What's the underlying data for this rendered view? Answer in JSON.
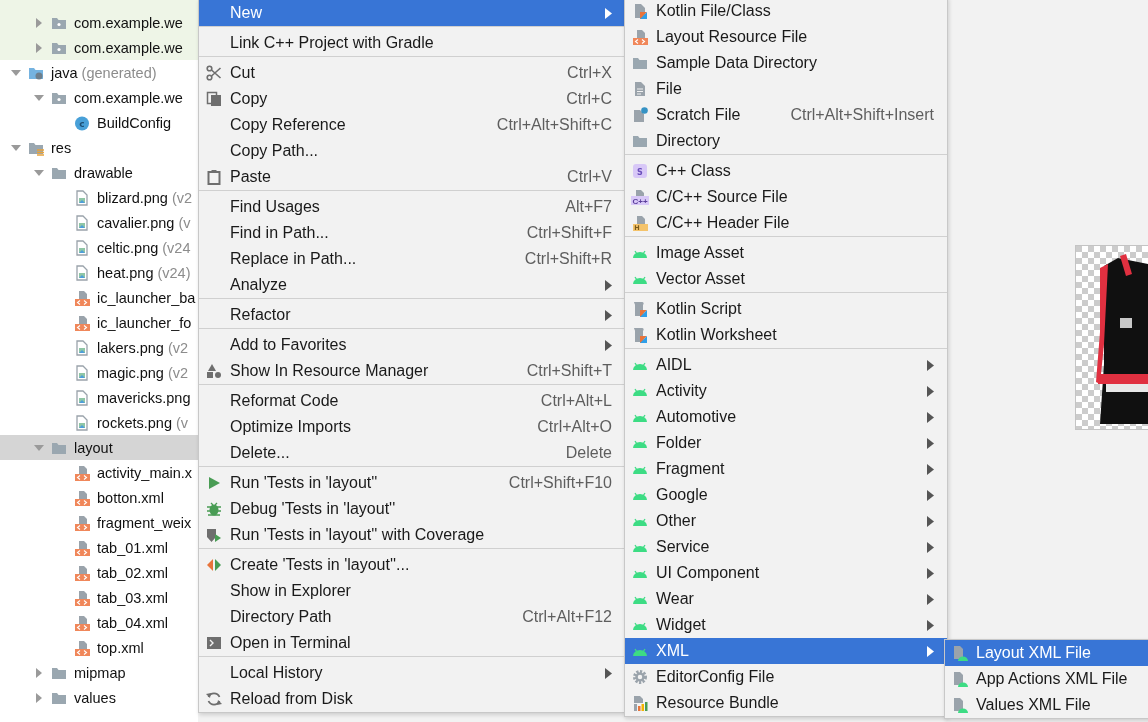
{
  "tree": {
    "items": [
      {
        "children": [
          {
            "label": "com.example.we",
            "kind": "package",
            "expanded": false,
            "selected": false,
            "tinted": true
          },
          {
            "label": "com.example.we",
            "kind": "package",
            "expanded": false,
            "selected": false,
            "tinted": true
          }
        ]
      },
      {
        "label": "java",
        "note": "(generated)",
        "kind": "java-root",
        "expanded": true,
        "selected": false,
        "children": [
          {
            "label": "com.example.we",
            "kind": "package",
            "expanded": true,
            "selected": false,
            "children": [
              {
                "label": "BuildConfig",
                "kind": "class",
                "badge": "c",
                "selected": false
              }
            ]
          }
        ]
      },
      {
        "label": "res",
        "kind": "res-root",
        "expanded": true,
        "selected": false,
        "children": [
          {
            "label": "drawable",
            "kind": "folder",
            "expanded": true,
            "selected": false,
            "children": [
              {
                "label": "blizard.png",
                "note": "(v2",
                "kind": "png",
                "selected": false
              },
              {
                "label": "cavalier.png",
                "note": "(v",
                "kind": "png",
                "selected": false
              },
              {
                "label": "celtic.png",
                "note": "(v24",
                "kind": "png",
                "selected": false
              },
              {
                "label": "heat.png",
                "note": "(v24)",
                "kind": "png",
                "selected": false
              },
              {
                "label": "ic_launcher_ba",
                "kind": "xml",
                "selected": false
              },
              {
                "label": "ic_launcher_fo",
                "kind": "xml",
                "selected": false
              },
              {
                "label": "lakers.png",
                "note": "(v2",
                "kind": "png",
                "selected": false
              },
              {
                "label": "magic.png",
                "note": "(v2",
                "kind": "png",
                "selected": false
              },
              {
                "label": "mavericks.png",
                "kind": "png",
                "selected": false
              },
              {
                "label": "rockets.png",
                "note": "(v",
                "kind": "png",
                "selected": false
              }
            ]
          },
          {
            "label": "layout",
            "kind": "folder",
            "expanded": true,
            "selected": true,
            "children": [
              {
                "label": "activity_main.x",
                "kind": "xml",
                "selected": false
              },
              {
                "label": "botton.xml",
                "kind": "xml",
                "selected": false
              },
              {
                "label": "fragment_weix",
                "kind": "xml",
                "selected": false
              },
              {
                "label": "tab_01.xml",
                "kind": "xml",
                "selected": false
              },
              {
                "label": "tab_02.xml",
                "kind": "xml",
                "selected": false
              },
              {
                "label": "tab_03.xml",
                "kind": "xml",
                "selected": false
              },
              {
                "label": "tab_04.xml",
                "kind": "xml",
                "selected": false
              },
              {
                "label": "top.xml",
                "kind": "xml",
                "selected": false
              }
            ]
          },
          {
            "label": "mipmap",
            "kind": "folder",
            "expanded": false,
            "selected": false
          },
          {
            "label": "values",
            "kind": "folder",
            "expanded": false,
            "selected": false
          }
        ]
      }
    ]
  },
  "context_menu": {
    "groups": [
      [
        {
          "label": "New",
          "kind": "plain",
          "submenu": true,
          "selected": true
        }
      ],
      [
        {
          "label": "Link C++ Project with Gradle",
          "kind": "plain",
          "submenu": false,
          "selected": false
        }
      ],
      [
        {
          "label": "Cut",
          "kind": "scissors",
          "shortcut": "Ctrl+X",
          "submenu": false,
          "selected": false
        },
        {
          "label": "Copy",
          "kind": "copy",
          "shortcut": "Ctrl+C",
          "submenu": false,
          "selected": false
        },
        {
          "label": "Copy Reference",
          "kind": "plain",
          "shortcut": "Ctrl+Alt+Shift+C",
          "submenu": false,
          "selected": false
        },
        {
          "label": "Copy Path...",
          "kind": "plain",
          "submenu": false,
          "selected": false
        },
        {
          "label": "Paste",
          "kind": "paste",
          "shortcut": "Ctrl+V",
          "submenu": false,
          "selected": false
        }
      ],
      [
        {
          "label": "Find Usages",
          "kind": "plain",
          "shortcut": "Alt+F7",
          "submenu": false,
          "selected": false
        },
        {
          "label": "Find in Path...",
          "kind": "plain",
          "shortcut": "Ctrl+Shift+F",
          "submenu": false,
          "selected": false
        },
        {
          "label": "Replace in Path...",
          "kind": "plain",
          "shortcut": "Ctrl+Shift+R",
          "submenu": false,
          "selected": false
        },
        {
          "label": "Analyze",
          "kind": "plain",
          "submenu": true,
          "selected": false
        }
      ],
      [
        {
          "label": "Refactor",
          "kind": "plain",
          "submenu": true,
          "selected": false
        }
      ],
      [
        {
          "label": "Add to Favorites",
          "kind": "plain",
          "submenu": true,
          "selected": false
        },
        {
          "label": "Show In Resource Manager",
          "kind": "shapes",
          "shortcut": "Ctrl+Shift+T",
          "submenu": false,
          "selected": false
        }
      ],
      [
        {
          "label": "Reformat Code",
          "kind": "plain",
          "shortcut": "Ctrl+Alt+L",
          "submenu": false,
          "selected": false
        },
        {
          "label": "Optimize Imports",
          "kind": "plain",
          "shortcut": "Ctrl+Alt+O",
          "submenu": false,
          "selected": false
        },
        {
          "label": "Delete...",
          "kind": "plain",
          "shortcut": "Delete",
          "submenu": false,
          "selected": false
        }
      ],
      [
        {
          "label": "Run 'Tests in 'layout''",
          "kind": "run",
          "shortcut": "Ctrl+Shift+F10",
          "submenu": false,
          "selected": false
        },
        {
          "label": "Debug 'Tests in 'layout''",
          "kind": "debug",
          "submenu": false,
          "selected": false
        },
        {
          "label": "Run 'Tests in 'layout'' with Coverage",
          "kind": "coverage",
          "submenu": false,
          "selected": false
        }
      ],
      [
        {
          "label": "Create 'Tests in 'layout''...",
          "kind": "create",
          "submenu": false,
          "selected": false
        },
        {
          "label": "Show in Explorer",
          "kind": "plain",
          "submenu": false,
          "selected": false
        },
        {
          "label": "Directory Path",
          "kind": "plain",
          "shortcut": "Ctrl+Alt+F12",
          "submenu": false,
          "selected": false
        },
        {
          "label": "Open in Terminal",
          "kind": "terminal",
          "submenu": false,
          "selected": false
        }
      ],
      [
        {
          "label": "Local History",
          "kind": "plain",
          "submenu": true,
          "selected": false
        },
        {
          "label": "Reload from Disk",
          "kind": "reload",
          "submenu": false,
          "selected": false
        }
      ]
    ]
  },
  "new_submenu": {
    "groups": [
      [
        {
          "label": "Kotlin File/Class",
          "kind": "kotlin-file",
          "submenu": false,
          "selected": false
        },
        {
          "label": "Layout Resource File",
          "kind": "layout-file",
          "submenu": false,
          "selected": false
        },
        {
          "label": "Sample Data Directory",
          "kind": "folder",
          "submenu": false,
          "selected": false
        },
        {
          "label": "File",
          "kind": "file",
          "submenu": false,
          "selected": false
        },
        {
          "label": "Scratch File",
          "kind": "scratch",
          "shortcut": "Ctrl+Alt+Shift+Insert",
          "submenu": false,
          "selected": false
        },
        {
          "label": "Directory",
          "kind": "folder",
          "submenu": false,
          "selected": false
        }
      ],
      [
        {
          "label": "C++ Class",
          "kind": "cpp-class",
          "badge": "S",
          "submenu": false,
          "selected": false
        },
        {
          "label": "C/C++ Source File",
          "kind": "source-file",
          "badge": "C++",
          "submenu": false,
          "selected": false
        },
        {
          "label": "C/C++ Header File",
          "kind": "header-file",
          "badge": "H",
          "submenu": false,
          "selected": false
        }
      ],
      [
        {
          "label": "Image Asset",
          "kind": "android",
          "submenu": false,
          "selected": false
        },
        {
          "label": "Vector Asset",
          "kind": "android",
          "submenu": false,
          "selected": false
        }
      ],
      [
        {
          "label": "Kotlin Script",
          "kind": "kotlin-script",
          "submenu": false,
          "selected": false
        },
        {
          "label": "Kotlin Worksheet",
          "kind": "kotlin-script",
          "submenu": false,
          "selected": false
        }
      ],
      [
        {
          "label": "AIDL",
          "kind": "android",
          "submenu": true,
          "selected": false
        },
        {
          "label": "Activity",
          "kind": "android",
          "submenu": true,
          "selected": false
        },
        {
          "label": "Automotive",
          "kind": "android",
          "submenu": true,
          "selected": false
        },
        {
          "label": "Folder",
          "kind": "android",
          "submenu": true,
          "selected": false
        },
        {
          "label": "Fragment",
          "kind": "android",
          "submenu": true,
          "selected": false
        },
        {
          "label": "Google",
          "kind": "android",
          "submenu": true,
          "selected": false
        },
        {
          "label": "Other",
          "kind": "android",
          "submenu": true,
          "selected": false
        },
        {
          "label": "Service",
          "kind": "android",
          "submenu": true,
          "selected": false
        },
        {
          "label": "UI Component",
          "kind": "android",
          "submenu": true,
          "selected": false
        },
        {
          "label": "Wear",
          "kind": "android",
          "submenu": true,
          "selected": false
        },
        {
          "label": "Widget",
          "kind": "android",
          "submenu": true,
          "selected": false
        },
        {
          "label": "XML",
          "kind": "android",
          "submenu": true,
          "selected": true
        },
        {
          "label": "EditorConfig File",
          "kind": "gear",
          "submenu": false,
          "selected": false
        },
        {
          "label": "Resource Bundle",
          "kind": "bundle",
          "submenu": false,
          "selected": false
        }
      ]
    ]
  },
  "xml_submenu": {
    "groups": [
      [
        {
          "label": "Layout XML File",
          "kind": "android-file",
          "submenu": false,
          "selected": true
        },
        {
          "label": "App Actions XML File",
          "kind": "android-file",
          "submenu": false,
          "selected": false
        },
        {
          "label": "Values XML File",
          "kind": "android-file",
          "submenu": false,
          "selected": false
        }
      ]
    ]
  }
}
